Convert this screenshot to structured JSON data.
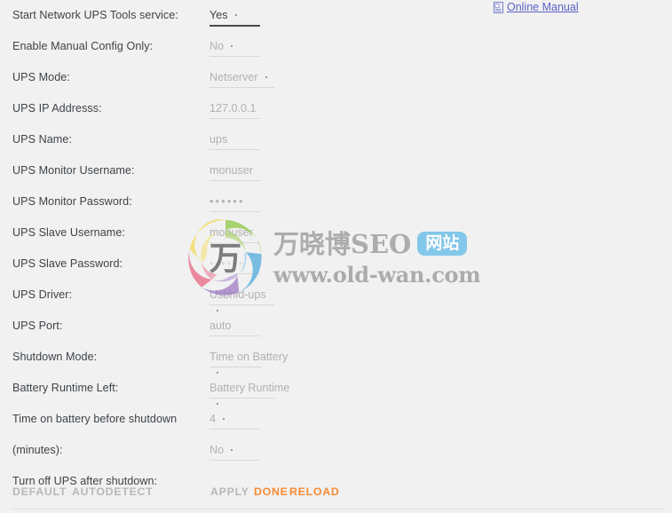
{
  "manual": {
    "label": "Online Manual",
    "icon": "document-icon",
    "color": "#5b62c4"
  },
  "form": {
    "rows": [
      {
        "label": "Start Network UPS Tools service:",
        "value": "Yes",
        "type": "select",
        "active": true,
        "width": "w-a",
        "caret": true
      },
      {
        "label": "Enable Manual Config Only:",
        "value": "No",
        "type": "select",
        "active": false,
        "width": "w-a",
        "caret": true
      },
      {
        "label": "UPS Mode:",
        "value": "Netserver",
        "type": "select",
        "active": false,
        "width": "w-b",
        "caret": true
      },
      {
        "label": "UPS IP Addresss:",
        "value": "127.0.0.1",
        "type": "text",
        "active": false,
        "width": "w-a",
        "caret": false
      },
      {
        "label": "UPS Name:",
        "value": "ups",
        "type": "text",
        "active": false,
        "width": "w-a",
        "caret": false
      },
      {
        "label": "UPS Monitor Username:",
        "value": "monuser",
        "type": "text",
        "active": false,
        "width": "w-a",
        "caret": false
      },
      {
        "label": "UPS Monitor Password:",
        "value": "••••••",
        "type": "password",
        "active": false,
        "width": "w-a",
        "caret": false
      },
      {
        "label": "UPS Slave Username:",
        "value": "monuser",
        "type": "text",
        "active": false,
        "width": "w-a",
        "caret": false
      },
      {
        "label": "UPS Slave Password:",
        "value": "••••••",
        "type": "password",
        "active": false,
        "width": "w-a",
        "caret": false
      },
      {
        "label": "UPS Driver:",
        "value": "Usbhid-ups",
        "type": "select",
        "active": false,
        "width": "w-b",
        "caret": true
      },
      {
        "label": "UPS Port:",
        "value": "auto",
        "type": "text",
        "active": false,
        "width": "w-a",
        "caret": false
      },
      {
        "label": "Shutdown Mode:",
        "value": "Time on Battery",
        "type": "select",
        "active": false,
        "width": "w-c",
        "caret": true
      },
      {
        "label": "Battery Runtime Left:",
        "value": "Battery Runtime",
        "type": "select",
        "active": false,
        "width": "w-b",
        "caret": true
      },
      {
        "label": "Time on battery before shutdown",
        "value": "4",
        "type": "text",
        "active": false,
        "width": "w-a",
        "caret": true
      },
      {
        "label": "(minutes):",
        "value": "No",
        "type": "select",
        "active": false,
        "width": "w-a",
        "caret": true
      },
      {
        "label": "Turn off UPS after shutdown:",
        "value": "",
        "type": "none",
        "active": false,
        "width": "w-a",
        "caret": false
      }
    ]
  },
  "actions": {
    "default_label": "DEFAULT",
    "autodetect_label": "AUTODETECT",
    "apply_label": "APPLY",
    "done_label": "DONE",
    "reload_label": "RELOAD",
    "muted_color": "#b8b8b8",
    "accent_color": "#f68b35"
  },
  "watermark": {
    "brand": "万晓博SEO",
    "badge": "网站",
    "url": "www.old-wan.com",
    "logo_glyph": "万",
    "badge_color": "#74c2ea",
    "text_color": "#a3a3a3"
  }
}
